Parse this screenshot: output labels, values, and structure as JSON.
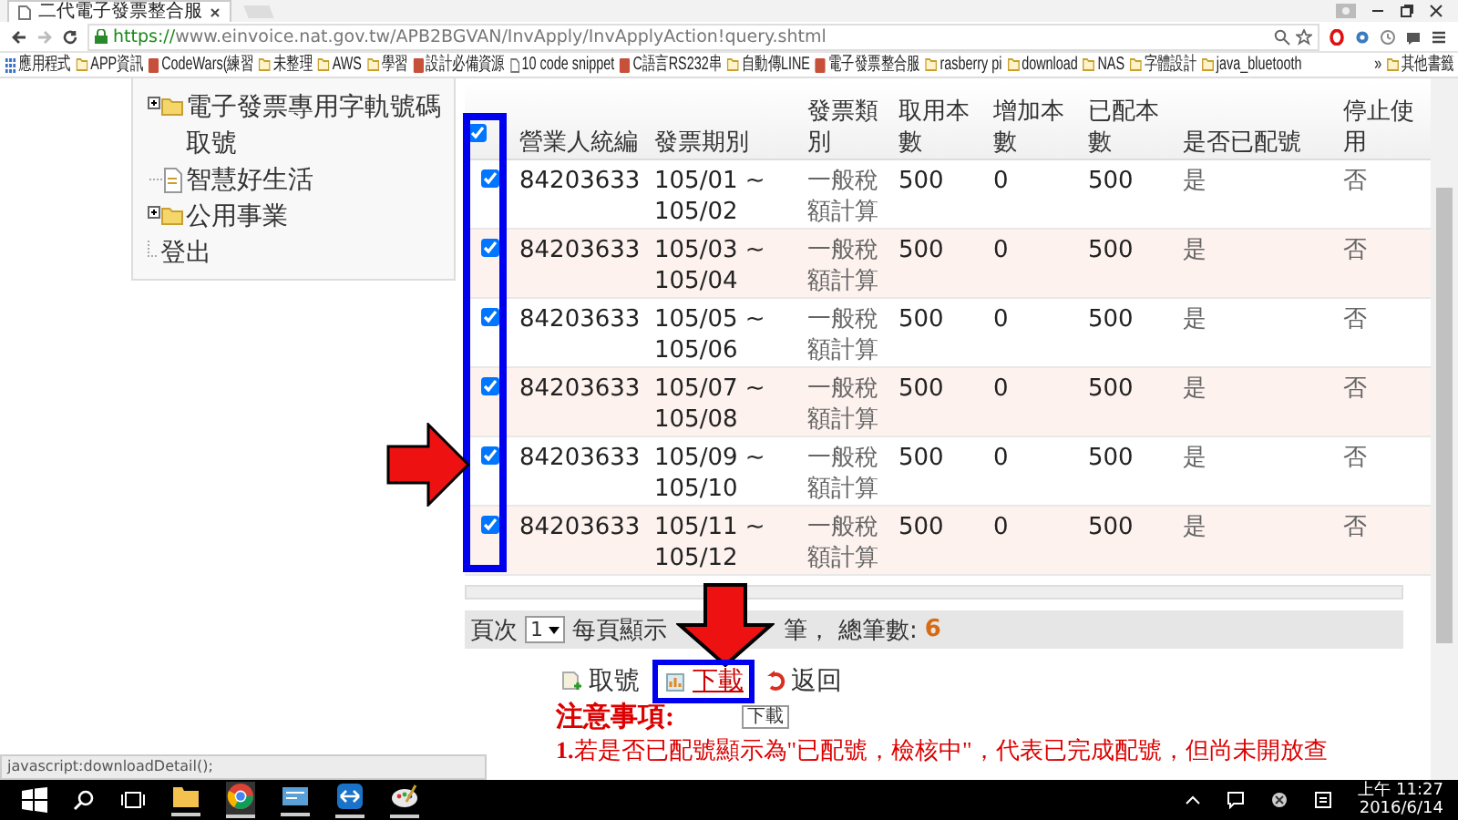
{
  "browser": {
    "tab_title": "二代電子發票整合服",
    "url_scheme": "https://",
    "url_rest": "www.einvoice.nat.gov.tw/APB2BGVAN/InvApply/InvApplyAction!query.shtml",
    "bookmarks": [
      {
        "label": "應用程式",
        "kind": "apps"
      },
      {
        "label": "APP資訊",
        "kind": "folder"
      },
      {
        "label": "CodeWars(練習",
        "kind": "site"
      },
      {
        "label": "未整理",
        "kind": "folder"
      },
      {
        "label": "AWS",
        "kind": "folder"
      },
      {
        "label": "學習",
        "kind": "folder"
      },
      {
        "label": "設計必備資源",
        "kind": "site"
      },
      {
        "label": "10 code snippet",
        "kind": "page"
      },
      {
        "label": "C語言RS232串",
        "kind": "site"
      },
      {
        "label": "自動傳LINE",
        "kind": "folder"
      },
      {
        "label": "電子發票整合服",
        "kind": "site"
      },
      {
        "label": "rasberry pi",
        "kind": "folder"
      },
      {
        "label": "download",
        "kind": "folder"
      },
      {
        "label": "NAS",
        "kind": "folder"
      },
      {
        "label": "字體設計",
        "kind": "folder"
      },
      {
        "label": "java_bluetooth",
        "kind": "folder"
      }
    ],
    "more": "»",
    "other_bookmarks": "其他書籤"
  },
  "sidebar": {
    "items": [
      {
        "label": "電子發票專用字軌號碼取號",
        "kind": "folder"
      },
      {
        "label": "智慧好生活",
        "kind": "page"
      },
      {
        "label": "公用事業",
        "kind": "folder"
      },
      {
        "label": "登出",
        "kind": "plain"
      }
    ]
  },
  "table": {
    "header_checked": true,
    "columns": [
      "營業人統編",
      "發票期別",
      "發票類別",
      "取用本數",
      "增加本數",
      "已配本數",
      "是否已配號",
      "停止使用"
    ],
    "rows": [
      {
        "checked": true,
        "cells": [
          "84203633",
          "105/01 ~ 105/02",
          "一般稅額計算",
          "500",
          "0",
          "500",
          "是",
          "否"
        ]
      },
      {
        "checked": true,
        "cells": [
          "84203633",
          "105/03 ~ 105/04",
          "一般稅額計算",
          "500",
          "0",
          "500",
          "是",
          "否"
        ]
      },
      {
        "checked": true,
        "cells": [
          "84203633",
          "105/05 ~ 105/06",
          "一般稅額計算",
          "500",
          "0",
          "500",
          "是",
          "否"
        ]
      },
      {
        "checked": true,
        "cells": [
          "84203633",
          "105/07 ~ 105/08",
          "一般稅額計算",
          "500",
          "0",
          "500",
          "是",
          "否"
        ]
      },
      {
        "checked": true,
        "cells": [
          "84203633",
          "105/09 ~ 105/10",
          "一般稅額計算",
          "500",
          "0",
          "500",
          "是",
          "否"
        ]
      },
      {
        "checked": true,
        "cells": [
          "84203633",
          "105/11 ~ 105/12",
          "一般稅額計算",
          "500",
          "0",
          "500",
          "是",
          "否"
        ]
      }
    ]
  },
  "pager": {
    "page_label": "頁次",
    "page": "1",
    "per_page_label": "每頁顯示",
    "unit": "筆，",
    "total_label": "總筆數:",
    "total": "6"
  },
  "actions": [
    {
      "label": "取號",
      "kind": "add"
    },
    {
      "label": "下載",
      "kind": "download"
    },
    {
      "label": "返回",
      "kind": "back"
    }
  ],
  "tooltip": "下載",
  "notes": {
    "title": "注意事項:",
    "line": "**1.**若是否已配號顯示為\"已配號，檢核中\"，代表已完成配號，但尚未開放查"
  },
  "status_url": "javascript:downloadDetail();",
  "taskbar": {
    "time": "上午 11:27",
    "date": "2016/6/14"
  }
}
